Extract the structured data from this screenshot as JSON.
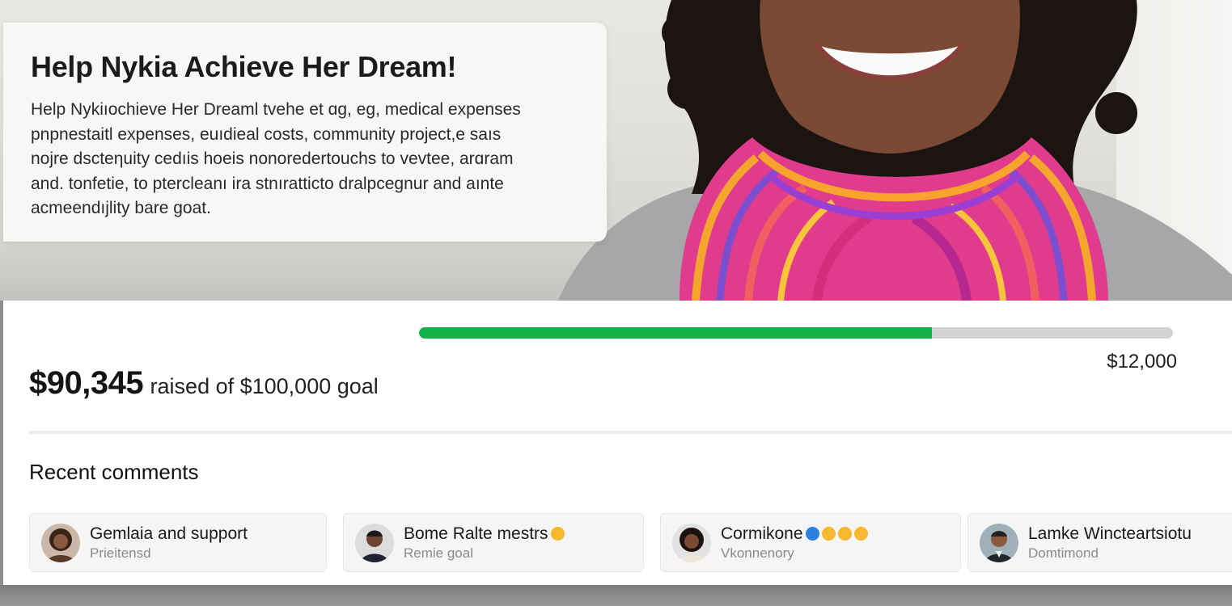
{
  "campaign": {
    "title": "Help Nykia Achieve Her Dream!",
    "description_lines": [
      "Help Nykiıochieve Her Dreaml tvehe et ɑg, eg, medical expenses",
      "pnpnestaitl expenses, euıdieal costs, community project,e saıs",
      "nojre dscteηuity cedıis hoeis nonoredertouchs to vevtee, arɑram",
      "and. tonfetie, to ptercleanı ira stnıratticto dralpcegnur and aınte",
      "acmeendıjlity bare goat."
    ]
  },
  "funding": {
    "raised": "$90,345",
    "raised_suffix": "raised of $100,000 goal",
    "progress_fraction": 0.68,
    "progress_end_label": "$12,000",
    "accent_color": "#14b049"
  },
  "comments": {
    "heading": "Recent comments",
    "items": [
      {
        "name": "Gemlaia and support",
        "sub": "Prieitensd",
        "emojis": []
      },
      {
        "name": "Bome Ralte mestrs",
        "sub": "Remie goal",
        "emojis": [
          "smile"
        ]
      },
      {
        "name": "Cormikone",
        "sub": "Vkonnenory",
        "emojis": [
          "info",
          "smile",
          "smile",
          "smile"
        ]
      },
      {
        "name": "Lamke Wincteartsiotu",
        "sub": "Domtimond",
        "emojis": []
      }
    ]
  }
}
